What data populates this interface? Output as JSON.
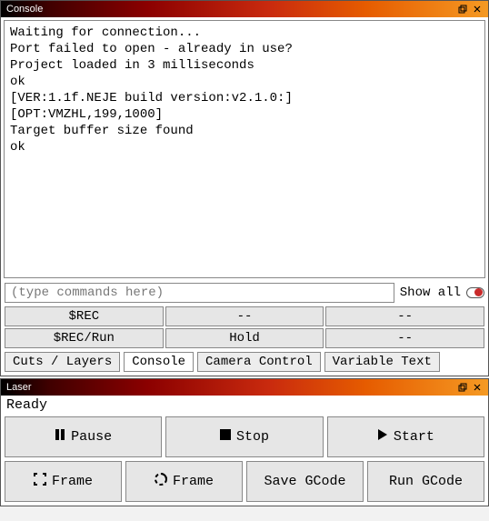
{
  "console": {
    "title": "Console",
    "log": [
      "Waiting for connection...",
      "Port failed to open - already in use?",
      "Project loaded in 3 milliseconds",
      "ok",
      "[VER:1.1f.NEJE build version:v2.1.0:]",
      "[OPT:VMZHL,199,1000]",
      "Target buffer size found",
      "ok"
    ],
    "input_placeholder": "(type commands here)",
    "showall_label": "Show all",
    "showall_on": false,
    "macros": [
      [
        "$REC",
        "--",
        "--"
      ],
      [
        "$REC/Run",
        "Hold",
        "--"
      ]
    ],
    "tabs": [
      "Cuts / Layers",
      "Console",
      "Camera Control",
      "Variable Text"
    ],
    "active_tab": 1
  },
  "laser": {
    "title": "Laser",
    "status": "Ready",
    "row1": {
      "pause": "Pause",
      "stop": "Stop",
      "start": "Start"
    },
    "row2": {
      "frame": "Frame",
      "frame2": "Frame",
      "save_gcode": "Save GCode",
      "run_gcode": "Run GCode"
    }
  }
}
